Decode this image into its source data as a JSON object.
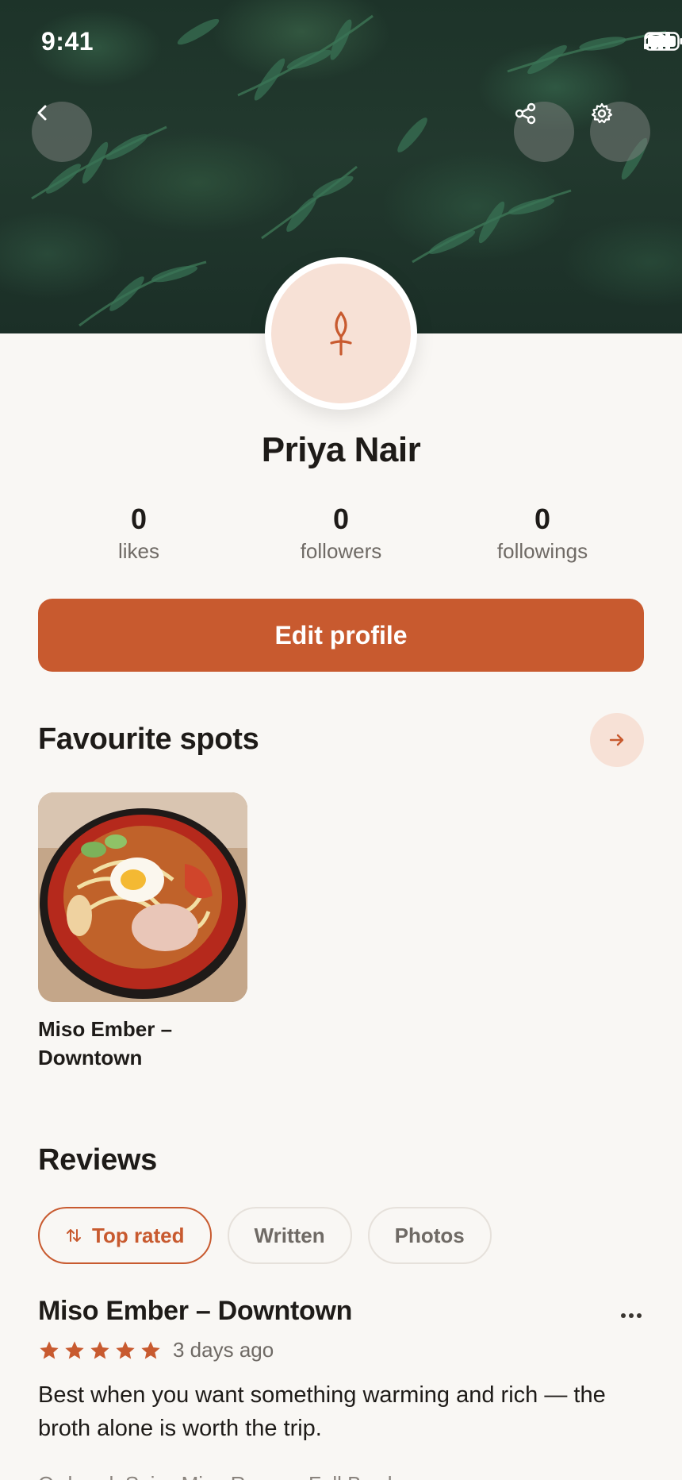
{
  "status_bar": {
    "time": "9:41"
  },
  "profile": {
    "name": "Priya Nair",
    "stats": [
      {
        "value": "0",
        "label": "likes"
      },
      {
        "value": "0",
        "label": "followers"
      },
      {
        "value": "0",
        "label": "followings"
      }
    ],
    "edit_label": "Edit profile"
  },
  "favourites": {
    "title": "Favourite spots",
    "spots": [
      {
        "name": "Miso Ember – Downtown"
      }
    ]
  },
  "reviews": {
    "title": "Reviews",
    "filters": [
      {
        "label": "Top rated",
        "active": true
      },
      {
        "label": "Written",
        "active": false
      },
      {
        "label": "Photos",
        "active": false
      }
    ],
    "items": [
      {
        "restaurant": "Miso Ember – Downtown",
        "rating": 5,
        "date": "3 days ago",
        "body": "Best when you want something warming and rich — the broth alone is worth the trip.",
        "ordered": "Ordered: Spicy Miso Ramen, Full Bowl"
      }
    ]
  },
  "colors": {
    "accent": "#c85a2f",
    "accent_soft": "#f7e1d6",
    "background": "#f9f7f4",
    "text": "#1e1b18",
    "muted": "#6f6a65"
  },
  "icons": {
    "back": "chevron-left-icon",
    "share": "share-icon",
    "settings": "gear-icon",
    "avatar": "sprout-icon",
    "more": "more-horizontal-icon",
    "arrow": "arrow-right-icon",
    "sort": "sort-arrows-icon",
    "star": "star-icon"
  }
}
